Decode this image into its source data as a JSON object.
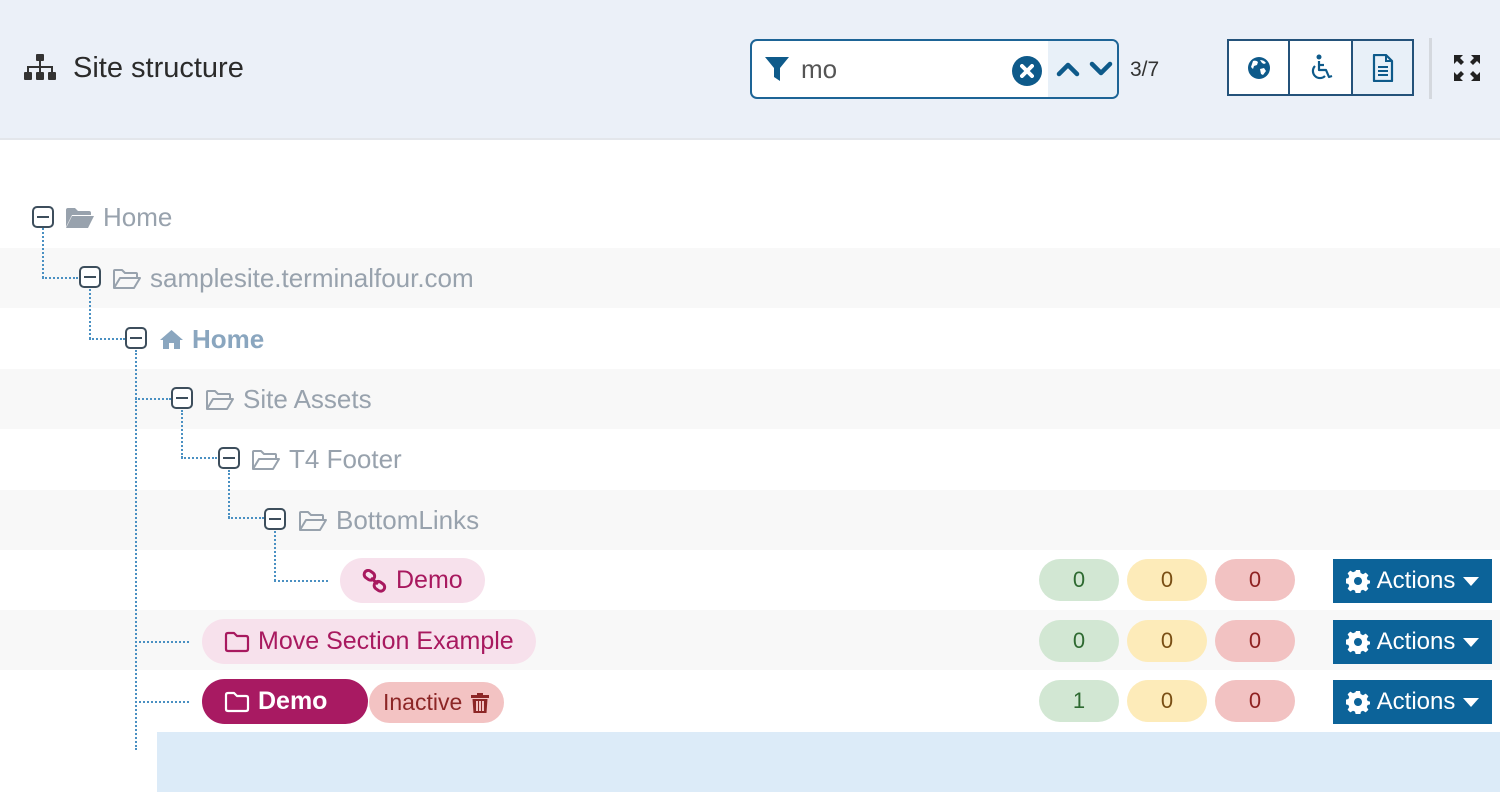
{
  "header": {
    "title": "Site structure",
    "title_icon": "sitemap-icon",
    "filter": {
      "value": "mo",
      "placeholder": "",
      "match_count": "3/7"
    },
    "view_modes": [
      {
        "name": "globe",
        "icon": "globe-icon",
        "active": false
      },
      {
        "name": "accessibility",
        "icon": "wheelchair-icon",
        "active": false
      },
      {
        "name": "content",
        "icon": "document-icon",
        "active": true
      }
    ],
    "fullscreen_icon": "expand-icon"
  },
  "tree": {
    "nodes": [
      {
        "label": "Home",
        "icon": "folder-open-solid-icon",
        "depth": 0,
        "expanded": true,
        "match": false
      },
      {
        "label": "samplesite.terminalfour.com",
        "icon": "folder-open-icon",
        "depth": 1,
        "expanded": true,
        "match": false
      },
      {
        "label": "Home",
        "icon": "home-icon",
        "depth": 2,
        "expanded": true,
        "match": false,
        "bold": true
      },
      {
        "label": "Site Assets",
        "icon": "folder-open-icon",
        "depth": 3,
        "expanded": true,
        "match": false
      },
      {
        "label": "T4 Footer",
        "icon": "folder-open-icon",
        "depth": 4,
        "expanded": true,
        "match": false
      },
      {
        "label": "BottomLinks",
        "icon": "folder-open-icon",
        "depth": 5,
        "expanded": true,
        "match": false
      },
      {
        "label": "Demo",
        "icon": "link-icon",
        "depth": 6,
        "match": true,
        "counts": {
          "approved": "0",
          "pending": "0",
          "inactive": "0"
        },
        "actions_label": "Actions"
      },
      {
        "label": "Move Section Example",
        "icon": "folder-icon",
        "depth": 3,
        "match": true,
        "counts": {
          "approved": "0",
          "pending": "0",
          "inactive": "0"
        },
        "actions_label": "Actions"
      },
      {
        "label": "Demo",
        "icon": "folder-icon",
        "depth": 3,
        "match": true,
        "current": true,
        "status_badge": "Inactive",
        "counts": {
          "approved": "1",
          "pending": "0",
          "inactive": "0"
        },
        "actions_label": "Actions"
      }
    ]
  },
  "colors": {
    "accent": "#0c6399",
    "match_pill": "#f7e1ec",
    "current_pill": "#a81a62",
    "count_green": "#d2e7d3",
    "count_yellow": "#fdebb9",
    "count_red": "#f2c2c2"
  }
}
